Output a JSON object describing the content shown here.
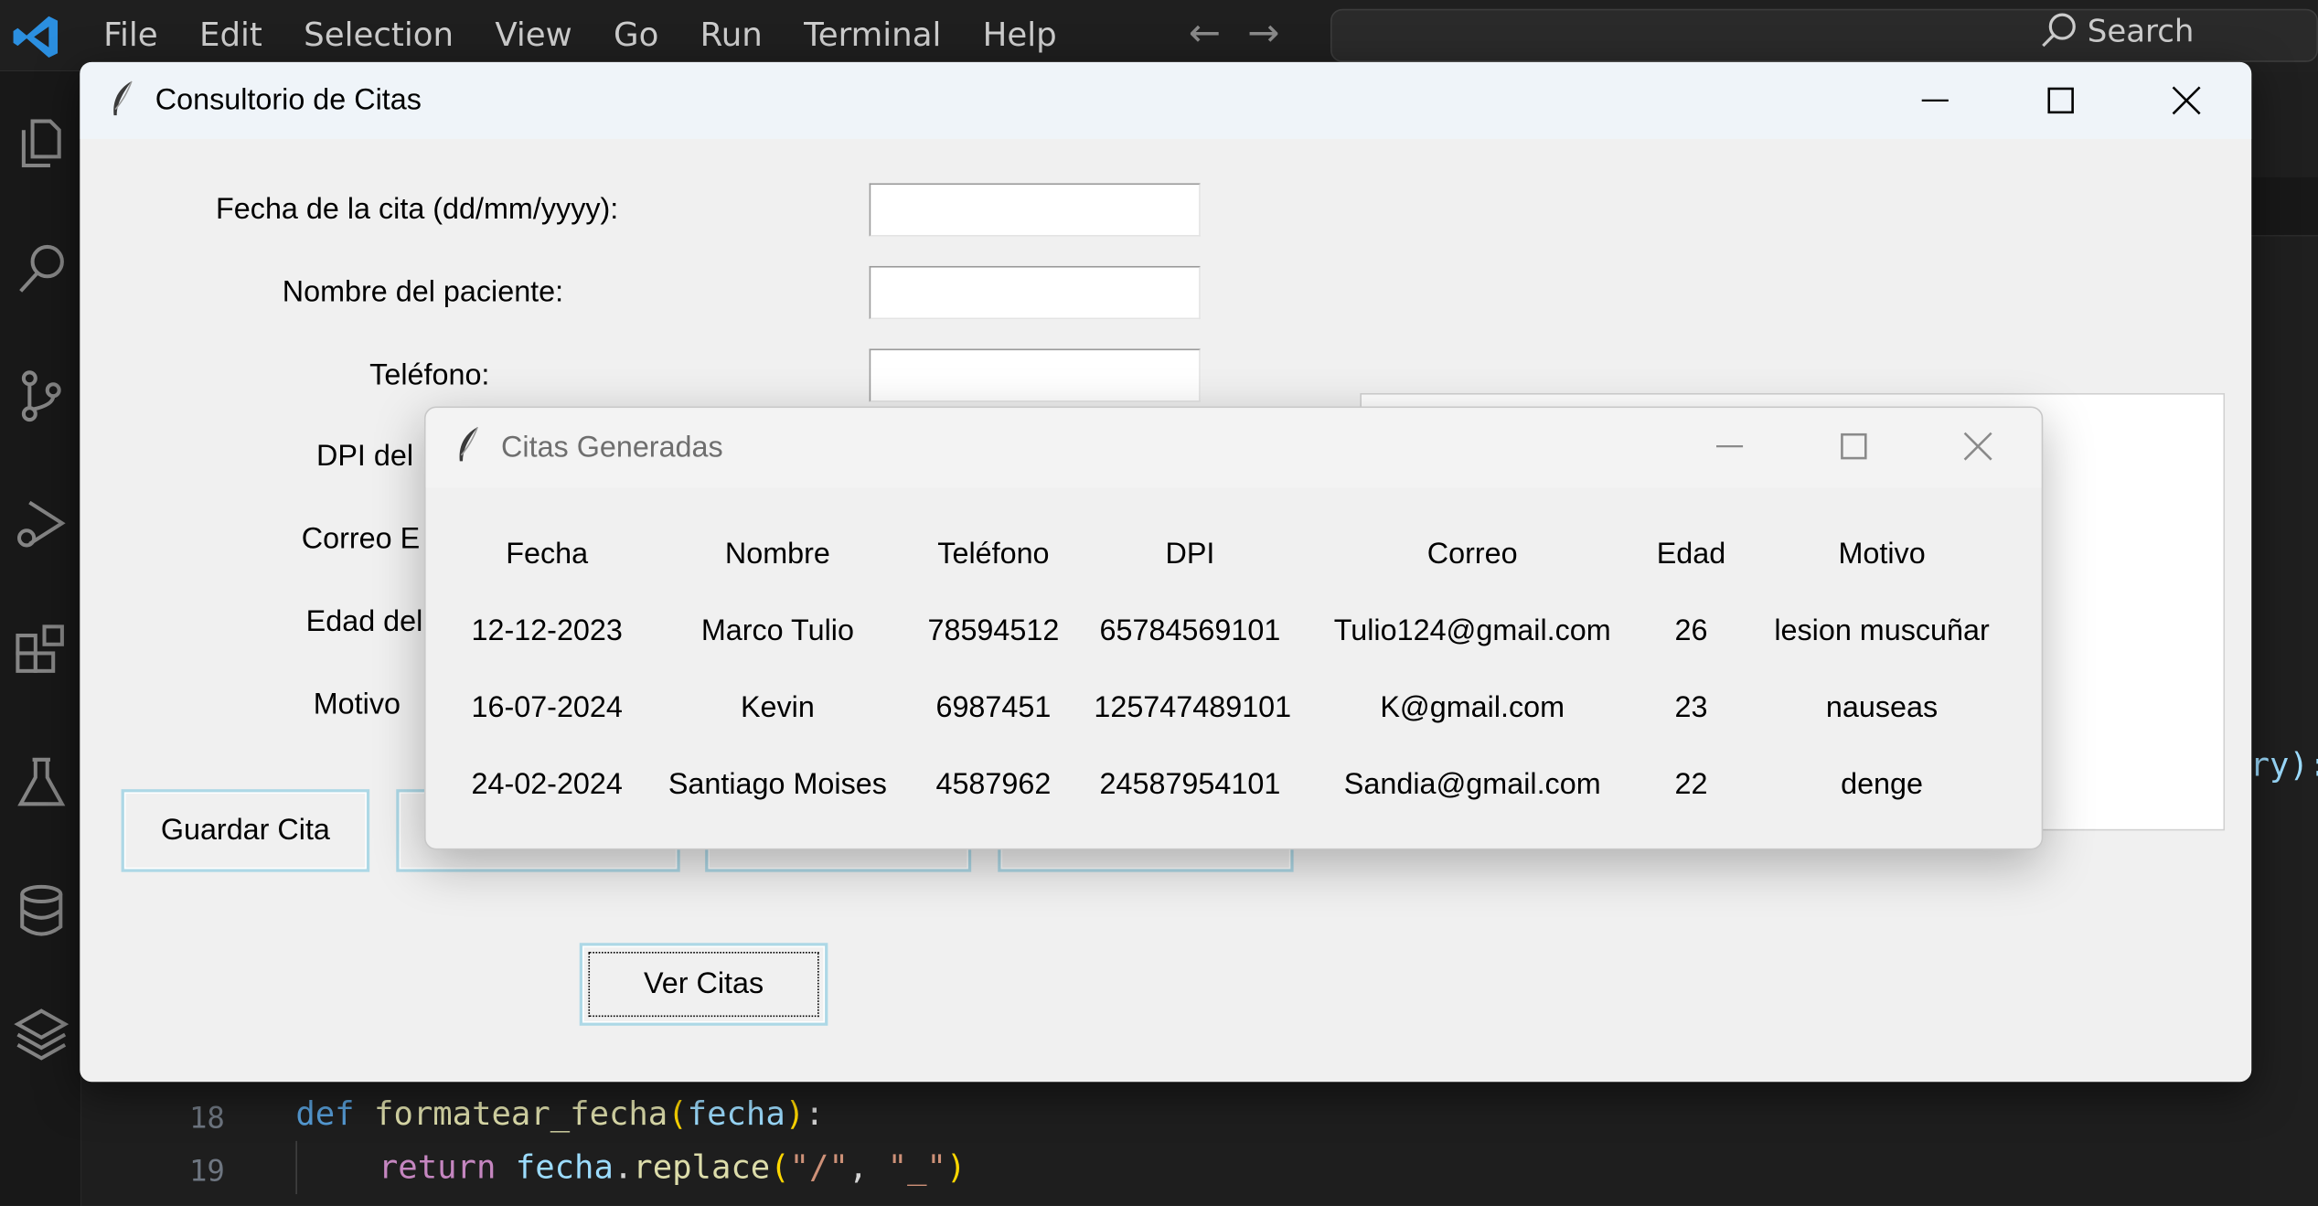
{
  "menu": [
    "File",
    "Edit",
    "Selection",
    "View",
    "Go",
    "Run",
    "Terminal",
    "Help"
  ],
  "nav": {
    "back": "←",
    "forward": "→"
  },
  "search": {
    "label": "Search"
  },
  "main_window": {
    "title": "Consultorio de Citas",
    "labels": {
      "fecha": "Fecha de la cita (dd/mm/yyyy):",
      "nombre": "Nombre del paciente:",
      "telefono": "Teléfono:",
      "dpi": "DPI del",
      "correo": "Correo E",
      "edad": "Edad del",
      "motivo": "Motivo"
    },
    "buttons": {
      "guardar": "Guardar Cita",
      "ver": "Ver Citas"
    }
  },
  "popup": {
    "title": "Citas Generadas",
    "headers": [
      "Fecha",
      "Nombre",
      "Teléfono",
      "DPI",
      "Correo",
      "Edad",
      "Motivo"
    ],
    "rows": [
      [
        "12-12-2023",
        "Marco Tulio",
        "78594512",
        "65784569101",
        "Tulio124@gmail.com",
        "26",
        "lesion muscuñar"
      ],
      [
        "16-07-2024",
        "Kevin",
        "6987451",
        "125747489101",
        "K@gmail.com",
        "23",
        "nauseas"
      ],
      [
        "24-02-2024",
        "Santiago Moises",
        "4587962",
        "24587954101",
        "Sandia@gmail.com",
        "22",
        "denge"
      ]
    ]
  },
  "code": {
    "lines": [
      {
        "num": "18",
        "def": "def",
        "name": "formatear_fecha",
        "paren_open": "(",
        "param": "fecha",
        "paren_close": ")",
        "colon": ":"
      },
      {
        "num": "19",
        "ret": "return",
        "obj": "fecha",
        "dot": ".",
        "method": "replace",
        "paren_open": "(",
        "arg1": "\"/\"",
        "comma": ", ",
        "arg2": "\"_\"",
        "paren_close": ")"
      }
    ],
    "right_fragment": "ry):"
  },
  "colors": {
    "accent_blue": "#0078d4",
    "button_border": "#add8e6",
    "editor_bg": "#1e1e1e"
  }
}
